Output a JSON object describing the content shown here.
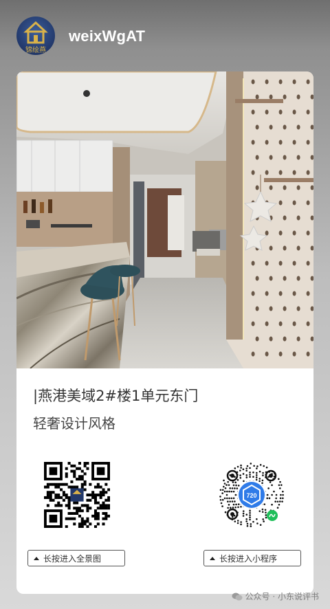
{
  "header": {
    "account_name": "weixWgAT",
    "avatar_text": "锦绘燕"
  },
  "card": {
    "title": "|燕港美域2#楼1单元东门",
    "subtitle": "轻奢设计风格",
    "left_button": "长按进入全景图",
    "right_button": "长按进入小程序",
    "mini_program_badge": "720"
  },
  "watermark": {
    "text": "公众号 · 小东说评书"
  },
  "colors": {
    "avatar_bg": "#22386a",
    "avatar_logo": "#d9b24a",
    "mini_program_blue": "#2f7be8",
    "mini_program_green": "#1fbf5a"
  }
}
